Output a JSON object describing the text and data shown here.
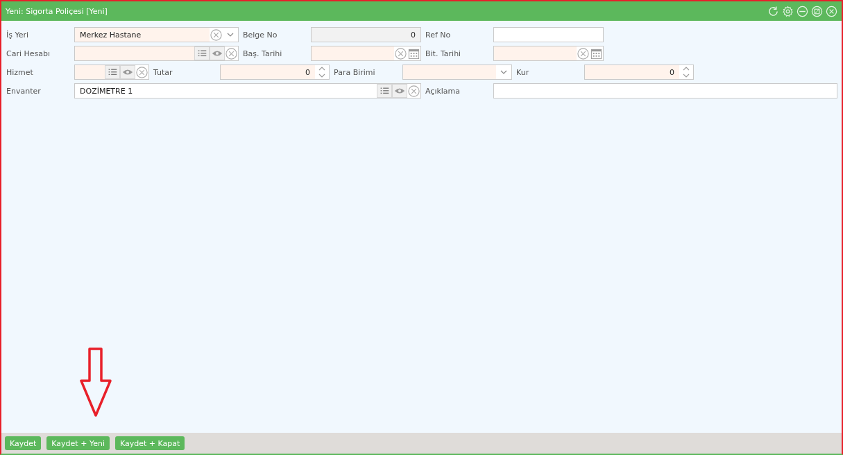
{
  "window": {
    "title": "Yeni: Sigorta Poliçesi [Yeni]"
  },
  "form": {
    "rows": [
      {
        "fields": [
          {
            "label": "İş Yeri",
            "kind": "combo",
            "value": "Merkez Hastane",
            "required": true,
            "disabled": false
          },
          {
            "label": "Belge No",
            "kind": "number",
            "value": "0",
            "required": false,
            "disabled": true
          },
          {
            "label": "Ref No",
            "kind": "text",
            "required": false,
            "disabled": false
          }
        ]
      },
      {
        "fields": [
          {
            "label": "Cari Hesabı",
            "kind": "lookup",
            "required": true,
            "disabled": false
          },
          {
            "label": "Baş. Tarihi",
            "kind": "date",
            "required": true,
            "disabled": false
          },
          {
            "label": "Bit. Tarihi",
            "kind": "date",
            "required": true,
            "disabled": false
          }
        ]
      },
      {
        "fields": [
          {
            "label": "Hizmet",
            "kind": "lookup",
            "required": true,
            "disabled": false
          },
          {
            "label": "Tutar",
            "kind": "spinner",
            "value": "0",
            "required": true,
            "disabled": false
          },
          {
            "label": "Para Birimi",
            "kind": "select",
            "required": true,
            "disabled": false
          },
          {
            "label": "Kur",
            "kind": "spinner",
            "value": "0",
            "required": true,
            "disabled": false
          }
        ]
      },
      {
        "fields": [
          {
            "label": "Envanter",
            "kind": "lookup",
            "value": "DOZİMETRE 1",
            "required": false,
            "disabled": false
          },
          {
            "label": "Açıklama",
            "kind": "text",
            "required": false,
            "disabled": false
          }
        ]
      }
    ]
  },
  "buttons": [
    {
      "label": "Kaydet"
    },
    {
      "label": "Kaydet + Yeni"
    },
    {
      "label": "Kaydet + Kapat"
    }
  ]
}
